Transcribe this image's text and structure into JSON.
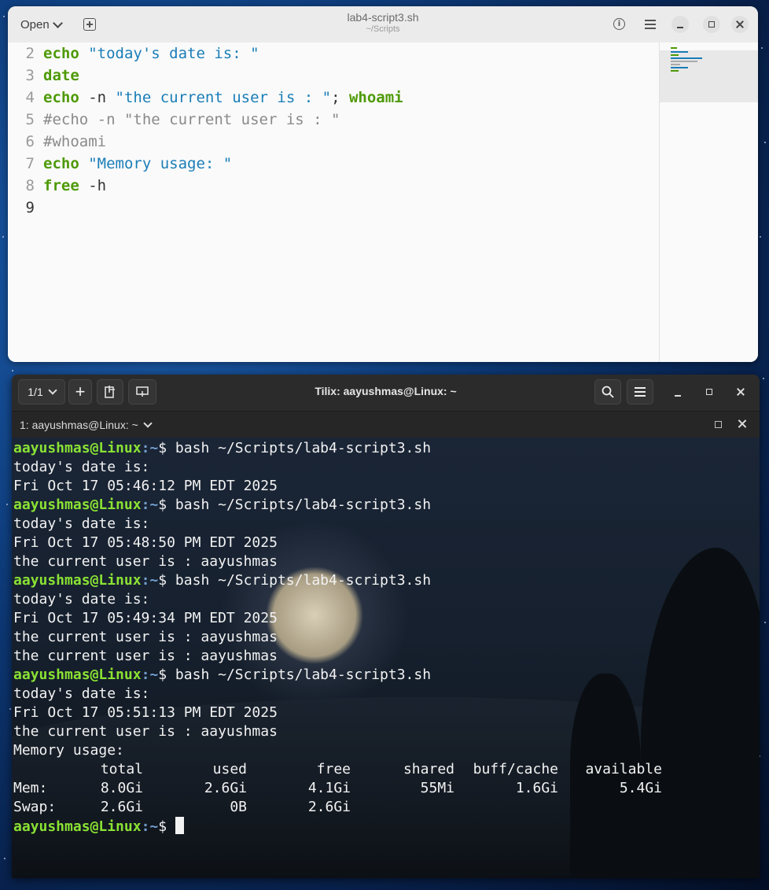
{
  "editor": {
    "open_label": "Open",
    "title": "lab4-script3.sh",
    "subtitle": "~/Scripts",
    "lines": [
      {
        "n": "2",
        "parts": [
          {
            "t": "echo",
            "c": "kw"
          },
          {
            "t": " \"today's date is: \"",
            "c": "str"
          }
        ]
      },
      {
        "n": "3",
        "parts": [
          {
            "t": "date",
            "c": "kw"
          }
        ]
      },
      {
        "n": "4",
        "parts": [
          {
            "t": "echo",
            "c": "kw"
          },
          {
            "t": " -n ",
            "c": "txt"
          },
          {
            "t": "\"the current user is : \"",
            "c": "str"
          },
          {
            "t": "; ",
            "c": "txt"
          },
          {
            "t": "whoami",
            "c": "kw"
          }
        ]
      },
      {
        "n": "5",
        "parts": [
          {
            "t": "#echo -n \"the current user is : \"",
            "c": "cmt"
          }
        ]
      },
      {
        "n": "6",
        "parts": [
          {
            "t": "#whoami",
            "c": "cmt"
          }
        ]
      },
      {
        "n": "7",
        "parts": [
          {
            "t": "echo",
            "c": "kw"
          },
          {
            "t": " \"Memory usage: \"",
            "c": "str"
          }
        ]
      },
      {
        "n": "8",
        "parts": [
          {
            "t": "free",
            "c": "kw"
          },
          {
            "t": " -h",
            "c": "txt"
          }
        ]
      },
      {
        "n": "9",
        "parts": []
      }
    ]
  },
  "terminal": {
    "session_label": "1/1",
    "title": "Tilix: aayushmas@Linux: ~",
    "tab_label": "1: aayushmas@Linux: ~",
    "prompt_user": "aayushmas@Linux",
    "prompt_path": ":~",
    "prompt_symbol": "$",
    "command": " bash ~/Scripts/lab4-script3.sh",
    "runs": [
      [
        "today's date is:",
        "Fri Oct 17 05:46:12 PM EDT 2025"
      ],
      [
        "today's date is:",
        "Fri Oct 17 05:48:50 PM EDT 2025",
        "the current user is : aayushmas"
      ],
      [
        "today's date is:",
        "Fri Oct 17 05:49:34 PM EDT 2025",
        "the current user is : aayushmas",
        "the current user is : aayushmas"
      ],
      [
        "today's date is:",
        "Fri Oct 17 05:51:13 PM EDT 2025",
        "the current user is : aayushmas",
        "Memory usage:"
      ]
    ],
    "free_table": {
      "headers": [
        "total",
        "used",
        "free",
        "shared",
        "buff/cache",
        "available"
      ],
      "rows": [
        {
          "label": "Mem:",
          "values": [
            "8.0Gi",
            "2.6Gi",
            "4.1Gi",
            "55Mi",
            "1.6Gi",
            "5.4Gi"
          ]
        },
        {
          "label": "Swap:",
          "values": [
            "2.6Gi",
            "0B",
            "2.6Gi",
            "",
            "",
            ""
          ]
        }
      ]
    }
  },
  "colors": {
    "prompt_user": "#8ae234",
    "prompt_path": "#729fcf",
    "keyword": "#4e9a06",
    "string": "#1a7db8"
  }
}
